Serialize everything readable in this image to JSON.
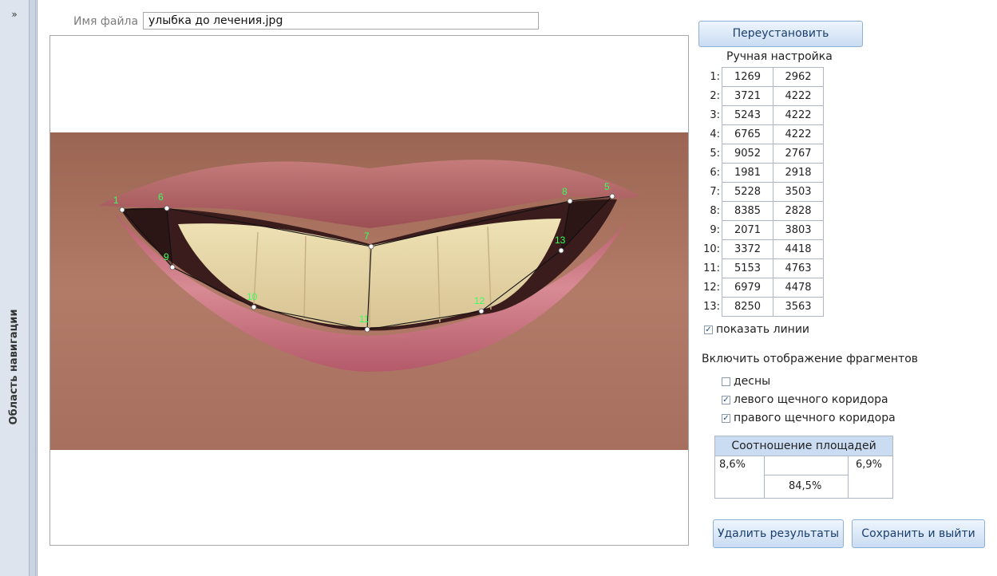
{
  "nav": {
    "toggle": "»",
    "label": "Область навигации"
  },
  "file": {
    "label": "Имя файла",
    "value": "улыбка до лечения.jpg"
  },
  "buttons": {
    "reset": "Переустановить",
    "delete": "Удалить результаты",
    "save": "Сохранить и выйти"
  },
  "manual": {
    "title": "Ручная настройка",
    "rows": [
      {
        "idx": "1:",
        "x": "1269",
        "y": "2962"
      },
      {
        "idx": "2:",
        "x": "3721",
        "y": "4222"
      },
      {
        "idx": "3:",
        "x": "5243",
        "y": "4222"
      },
      {
        "idx": "4:",
        "x": "6765",
        "y": "4222"
      },
      {
        "idx": "5:",
        "x": "9052",
        "y": "2767"
      },
      {
        "idx": "6:",
        "x": "1981",
        "y": "2918"
      },
      {
        "idx": "7:",
        "x": "5228",
        "y": "3503"
      },
      {
        "idx": "8:",
        "x": "8385",
        "y": "2828"
      },
      {
        "idx": "9:",
        "x": "2071",
        "y": "3803"
      },
      {
        "idx": "10:",
        "x": "3372",
        "y": "4418"
      },
      {
        "idx": "11:",
        "x": "5153",
        "y": "4763"
      },
      {
        "idx": "12:",
        "x": "6979",
        "y": "4478"
      },
      {
        "idx": "13:",
        "x": "8250",
        "y": "3563"
      }
    ]
  },
  "options": {
    "show_lines": {
      "label": "показать линии",
      "checked": true
    },
    "fragments_title": "Включить отображение фрагментов",
    "gums": {
      "label": "десны",
      "checked": false
    },
    "left_corridor": {
      "label": "левого щечного коридора",
      "checked": true
    },
    "right_corridor": {
      "label": "правого щечного коридора",
      "checked": true
    }
  },
  "ratio": {
    "title": "Соотношение площадей",
    "left": "8,6%",
    "right": "6,9%",
    "center": "84,5%"
  },
  "image": {
    "point_labels": [
      "1",
      "6",
      "9",
      "10",
      "11",
      "12",
      "13",
      "8",
      "5",
      "7"
    ]
  }
}
